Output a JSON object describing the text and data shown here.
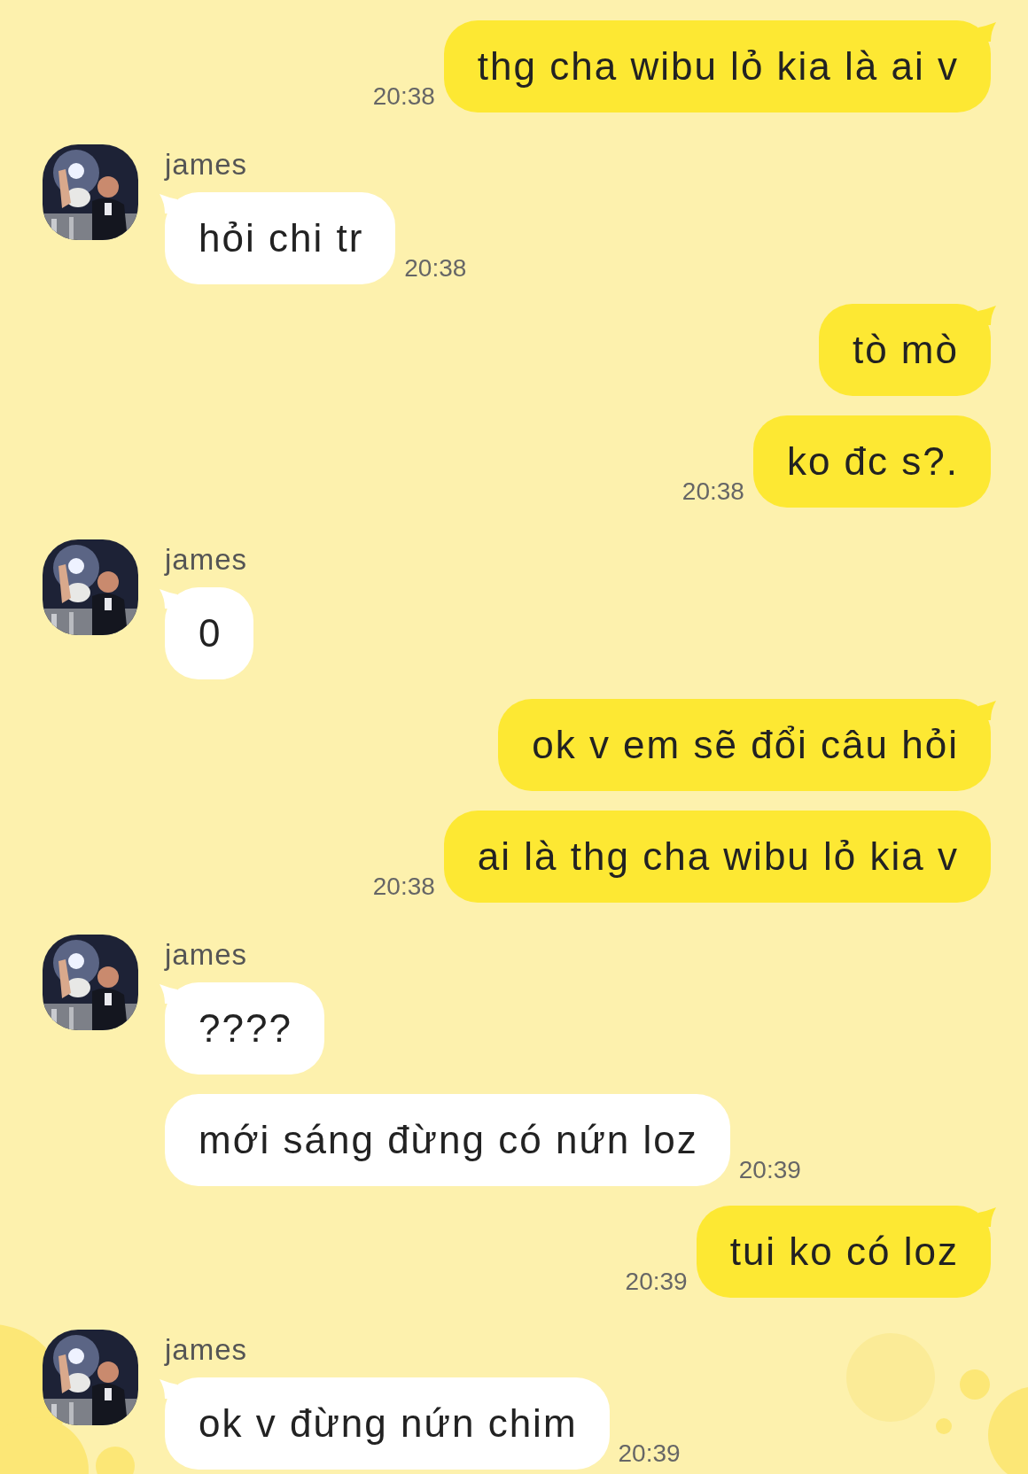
{
  "messages": [
    {
      "kind": "sent",
      "text": "thg cha wibu lỏ kia là ai v",
      "time": "20:38"
    },
    {
      "kind": "received",
      "sender": "james",
      "text": "hỏi chi tr",
      "time": "20:38"
    },
    {
      "kind": "sent",
      "text": "tò mò"
    },
    {
      "kind": "sent",
      "text": "ko đc s?.",
      "time": "20:38"
    },
    {
      "kind": "received",
      "sender": "james",
      "text": "0"
    },
    {
      "kind": "sent",
      "text": "ok v em sẽ đổi câu hỏi"
    },
    {
      "kind": "sent",
      "text": "ai là thg cha wibu lỏ kia v",
      "time": "20:38"
    },
    {
      "kind": "received",
      "sender": "james",
      "text": "????"
    },
    {
      "kind": "received",
      "text": "mới sáng đừng có nứn loz",
      "time": "20:39"
    },
    {
      "kind": "sent",
      "text": "tui ko có loz",
      "time": "20:39"
    },
    {
      "kind": "received",
      "sender": "james",
      "text": "ok v đừng nứn chim",
      "time": "20:39"
    }
  ]
}
